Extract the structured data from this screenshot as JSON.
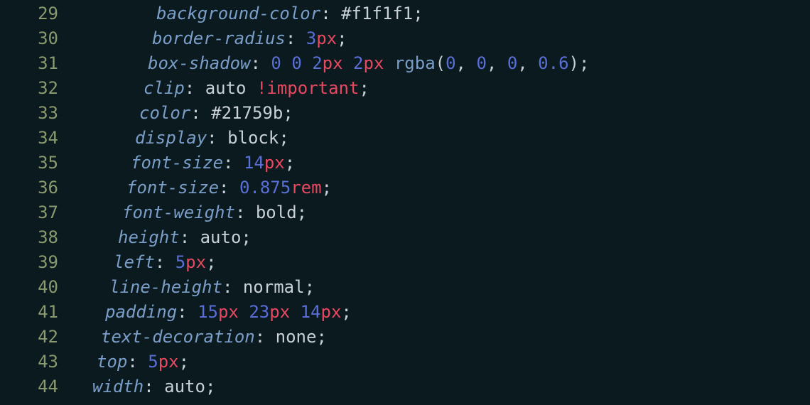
{
  "editor": {
    "gutter_start": 29,
    "indent_base": 120,
    "indent_step": -6,
    "lines": [
      {
        "ln": 29,
        "tokens": [
          {
            "t": "prop",
            "v": "background-color"
          },
          {
            "t": "colon",
            "v": ": "
          },
          {
            "t": "hex",
            "v": "#f1f1f1"
          },
          {
            "t": "semi",
            "v": ";"
          }
        ]
      },
      {
        "ln": 30,
        "tokens": [
          {
            "t": "prop",
            "v": "border-radius"
          },
          {
            "t": "colon",
            "v": ": "
          },
          {
            "t": "num",
            "v": "3"
          },
          {
            "t": "unit",
            "v": "px"
          },
          {
            "t": "semi",
            "v": ";"
          }
        ]
      },
      {
        "ln": 31,
        "tokens": [
          {
            "t": "prop",
            "v": "box-shadow"
          },
          {
            "t": "colon",
            "v": ": "
          },
          {
            "t": "num",
            "v": "0"
          },
          {
            "t": "value",
            "v": " "
          },
          {
            "t": "num",
            "v": "0"
          },
          {
            "t": "value",
            "v": " "
          },
          {
            "t": "num",
            "v": "2"
          },
          {
            "t": "unit",
            "v": "px"
          },
          {
            "t": "value",
            "v": " "
          },
          {
            "t": "num",
            "v": "2"
          },
          {
            "t": "unit",
            "v": "px"
          },
          {
            "t": "value",
            "v": " "
          },
          {
            "t": "func",
            "v": "rgba"
          },
          {
            "t": "paren",
            "v": "("
          },
          {
            "t": "num",
            "v": "0"
          },
          {
            "t": "comma",
            "v": ", "
          },
          {
            "t": "num",
            "v": "0"
          },
          {
            "t": "comma",
            "v": ", "
          },
          {
            "t": "num",
            "v": "0"
          },
          {
            "t": "comma",
            "v": ", "
          },
          {
            "t": "num",
            "v": "0.6"
          },
          {
            "t": "paren",
            "v": ")"
          },
          {
            "t": "semi",
            "v": ";"
          }
        ]
      },
      {
        "ln": 32,
        "tokens": [
          {
            "t": "prop",
            "v": "clip"
          },
          {
            "t": "colon",
            "v": ": "
          },
          {
            "t": "value",
            "v": "auto "
          },
          {
            "t": "important",
            "v": "!important"
          },
          {
            "t": "semi",
            "v": ";"
          }
        ]
      },
      {
        "ln": 33,
        "tokens": [
          {
            "t": "prop",
            "v": "color"
          },
          {
            "t": "colon",
            "v": ": "
          },
          {
            "t": "hex",
            "v": "#21759b"
          },
          {
            "t": "semi",
            "v": ";"
          }
        ]
      },
      {
        "ln": 34,
        "tokens": [
          {
            "t": "prop",
            "v": "display"
          },
          {
            "t": "colon",
            "v": ": "
          },
          {
            "t": "value",
            "v": "block"
          },
          {
            "t": "semi",
            "v": ";"
          }
        ]
      },
      {
        "ln": 35,
        "tokens": [
          {
            "t": "prop",
            "v": "font-size"
          },
          {
            "t": "colon",
            "v": ": "
          },
          {
            "t": "num",
            "v": "14"
          },
          {
            "t": "unit",
            "v": "px"
          },
          {
            "t": "semi",
            "v": ";"
          }
        ]
      },
      {
        "ln": 36,
        "tokens": [
          {
            "t": "prop",
            "v": "font-size"
          },
          {
            "t": "colon",
            "v": ": "
          },
          {
            "t": "num",
            "v": "0.875"
          },
          {
            "t": "unit",
            "v": "rem"
          },
          {
            "t": "semi",
            "v": ";"
          }
        ]
      },
      {
        "ln": 37,
        "tokens": [
          {
            "t": "prop",
            "v": "font-weight"
          },
          {
            "t": "colon",
            "v": ": "
          },
          {
            "t": "value",
            "v": "bold"
          },
          {
            "t": "semi",
            "v": ";"
          }
        ]
      },
      {
        "ln": 38,
        "tokens": [
          {
            "t": "prop",
            "v": "height"
          },
          {
            "t": "colon",
            "v": ": "
          },
          {
            "t": "value",
            "v": "auto"
          },
          {
            "t": "semi",
            "v": ";"
          }
        ]
      },
      {
        "ln": 39,
        "tokens": [
          {
            "t": "prop",
            "v": "left"
          },
          {
            "t": "colon",
            "v": ": "
          },
          {
            "t": "num",
            "v": "5"
          },
          {
            "t": "unit",
            "v": "px"
          },
          {
            "t": "semi",
            "v": ";"
          }
        ]
      },
      {
        "ln": 40,
        "tokens": [
          {
            "t": "prop",
            "v": "line-height"
          },
          {
            "t": "colon",
            "v": ": "
          },
          {
            "t": "value",
            "v": "normal"
          },
          {
            "t": "semi",
            "v": ";"
          }
        ]
      },
      {
        "ln": 41,
        "tokens": [
          {
            "t": "prop",
            "v": "padding"
          },
          {
            "t": "colon",
            "v": ": "
          },
          {
            "t": "num",
            "v": "15"
          },
          {
            "t": "unit",
            "v": "px"
          },
          {
            "t": "value",
            "v": " "
          },
          {
            "t": "num",
            "v": "23"
          },
          {
            "t": "unit",
            "v": "px"
          },
          {
            "t": "value",
            "v": " "
          },
          {
            "t": "num",
            "v": "14"
          },
          {
            "t": "unit",
            "v": "px"
          },
          {
            "t": "semi",
            "v": ";"
          }
        ]
      },
      {
        "ln": 42,
        "tokens": [
          {
            "t": "prop",
            "v": "text-decoration"
          },
          {
            "t": "colon",
            "v": ": "
          },
          {
            "t": "value",
            "v": "none"
          },
          {
            "t": "semi",
            "v": ";"
          }
        ]
      },
      {
        "ln": 43,
        "tokens": [
          {
            "t": "prop",
            "v": "top"
          },
          {
            "t": "colon",
            "v": ": "
          },
          {
            "t": "num",
            "v": "5"
          },
          {
            "t": "unit",
            "v": "px"
          },
          {
            "t": "semi",
            "v": ";"
          }
        ]
      },
      {
        "ln": 44,
        "tokens": [
          {
            "t": "prop",
            "v": "width"
          },
          {
            "t": "colon",
            "v": ": "
          },
          {
            "t": "value",
            "v": "auto"
          },
          {
            "t": "semi",
            "v": ";"
          }
        ]
      }
    ]
  }
}
